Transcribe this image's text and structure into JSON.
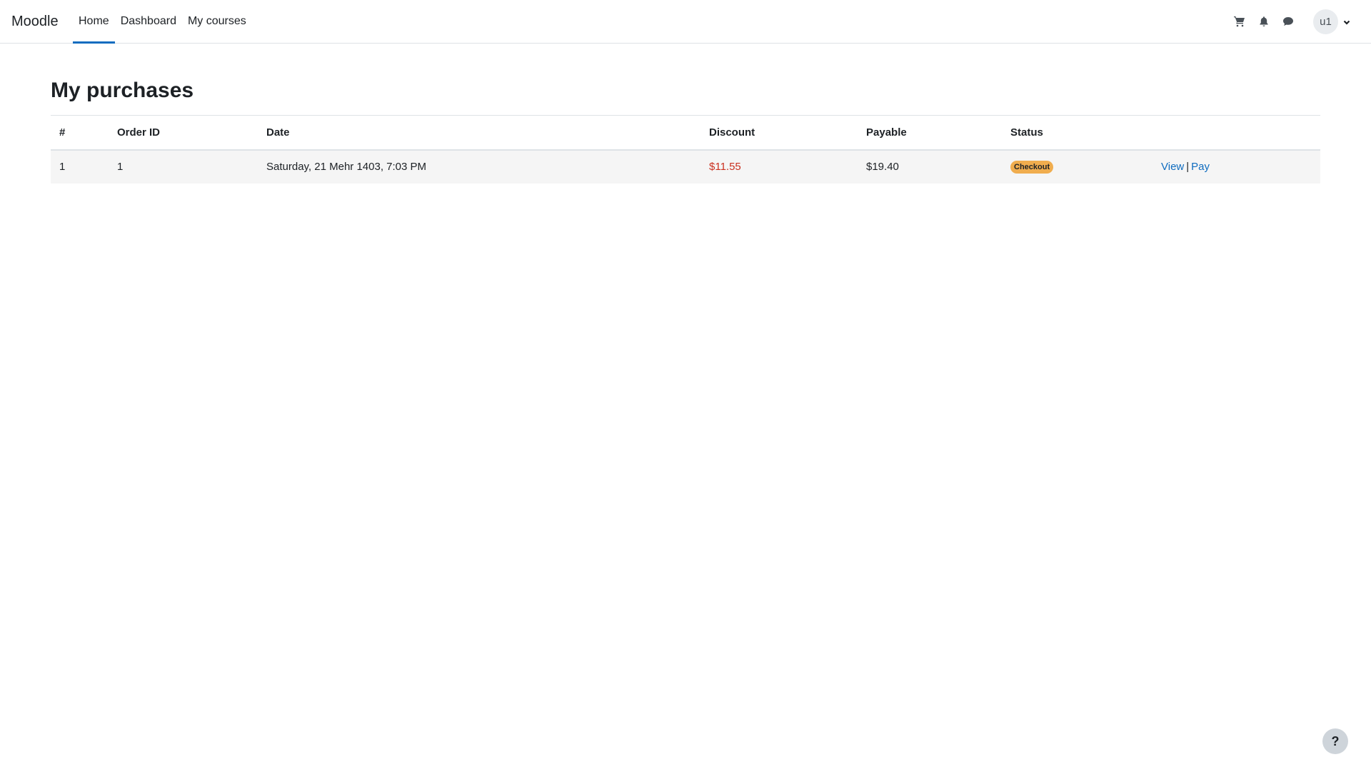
{
  "nav": {
    "brand": "Moodle",
    "links": [
      {
        "label": "Home",
        "active": true
      },
      {
        "label": "Dashboard",
        "active": false
      },
      {
        "label": "My courses",
        "active": false
      }
    ],
    "icons": [
      "cart-icon",
      "bell-icon",
      "chat-icon"
    ],
    "user_initials": "u1"
  },
  "main": {
    "title": "My purchases",
    "table": {
      "headers": [
        "#",
        "Order ID",
        "Date",
        "Discount",
        "Payable",
        "Status",
        ""
      ],
      "rows": [
        {
          "index": "1",
          "order_id": "1",
          "date": "Saturday, 21 Mehr 1403, 7:03 PM",
          "discount": "$11.55",
          "payable": "$19.40",
          "status": "Checkout",
          "actions": {
            "view": "View",
            "separator": "|",
            "pay": "Pay"
          }
        }
      ]
    }
  },
  "help": {
    "label": "?"
  },
  "colors": {
    "accent": "#0f6cbf",
    "discount": "#ca3120",
    "badge_warning": "#f0ad4e"
  }
}
